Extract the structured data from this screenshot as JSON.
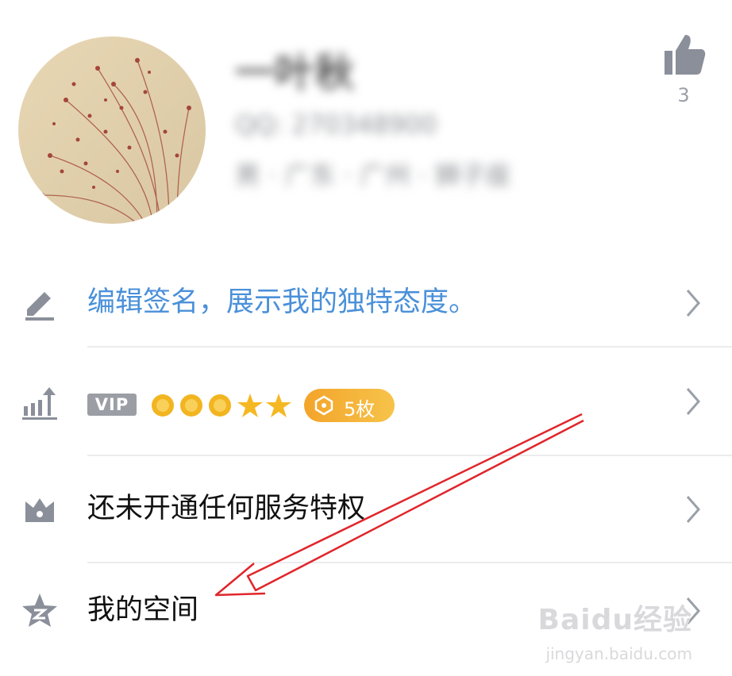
{
  "profile": {
    "nickname": "一叶秋",
    "qq_line": "QQ: 270348900",
    "location_line": "男 · 广东 · 广州 · 狮子座",
    "likes": "3"
  },
  "menu": {
    "signature": "编辑签名，展示我的独特态度。",
    "vip_badge": "VIP",
    "coin_count": "5枚",
    "privilege": "还未开通任何服务特权",
    "qzone": "我的空间"
  },
  "watermark": {
    "brand": "Baidu经验",
    "url": "jingyan.baidu.com"
  },
  "colors": {
    "accent_blue": "#4a90d9",
    "icon_gray": "#8a8f9a",
    "coin_orange": "#f3a42a",
    "annotation_red": "#e0262b"
  }
}
